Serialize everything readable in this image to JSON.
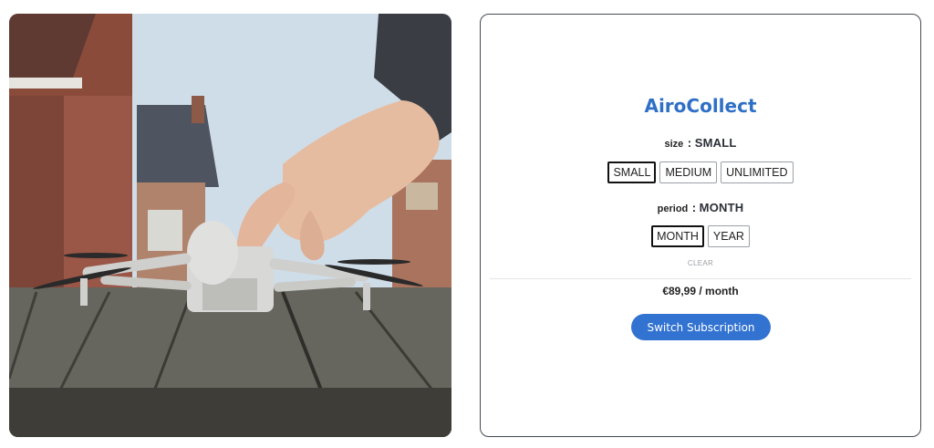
{
  "product": {
    "title": "AiroCollect",
    "image_subject": "drone on wooden table"
  },
  "options": {
    "size": {
      "name": "size",
      "separator": ":",
      "selected": "SMALL",
      "values": [
        "SMALL",
        "MEDIUM",
        "UNLIMITED"
      ]
    },
    "period": {
      "name": "period",
      "separator": ":",
      "selected": "MONTH",
      "values": [
        "MONTH",
        "YEAR"
      ]
    }
  },
  "clear_label": "CLEAR",
  "price": "€89,99 / month",
  "cta_label": "Switch Subscription",
  "colors": {
    "accent": "#2f6fc6",
    "button": "#3273d1",
    "card_border": "#444a52"
  }
}
